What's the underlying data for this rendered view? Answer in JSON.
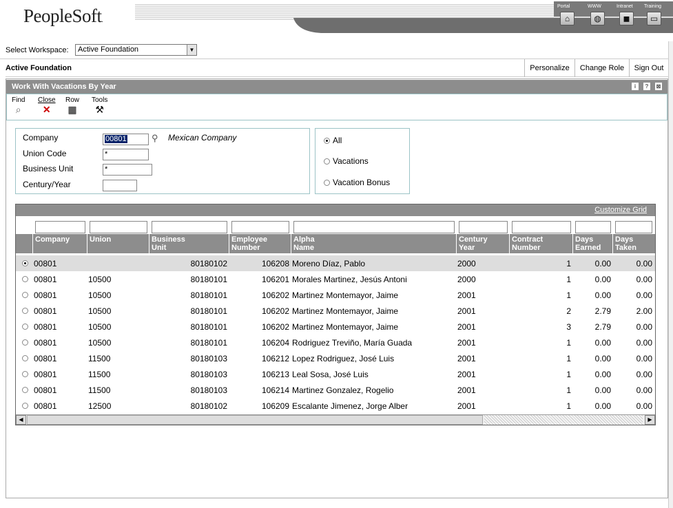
{
  "brand": {
    "logo_text": "PeopleSoft",
    "logo_dot": "."
  },
  "banner": {
    "nav": [
      {
        "label": "Portal",
        "icon": "home-icon",
        "glyph": "⌂"
      },
      {
        "label": "WWW",
        "icon": "globe-icon",
        "glyph": "◍"
      },
      {
        "label": "Intranet",
        "icon": "book-icon",
        "glyph": "◼"
      },
      {
        "label": "Training",
        "icon": "computer-icon",
        "glyph": "▭"
      }
    ]
  },
  "workspace": {
    "label": "Select Workspace:",
    "value": "Active Foundation"
  },
  "topbar": {
    "title": "Active Foundation",
    "personalize": "Personalize",
    "change_role": "Change Role",
    "sign_out": "Sign Out"
  },
  "form": {
    "title": "Work With Vacations By Year"
  },
  "toolbar": {
    "find": "Find",
    "close": "Close",
    "row": "Row",
    "tools": "Tools"
  },
  "fields": {
    "company_label": "Company",
    "company_value": "00801",
    "company_desc": "Mexican Company",
    "union_label": "Union Code",
    "union_value": "*",
    "bu_label": "Business Unit",
    "bu_value": "*",
    "year_label": "Century/Year",
    "year_value": ""
  },
  "radios": {
    "all": "All",
    "vacations": "Vacations",
    "bonus": "Vacation Bonus",
    "selected": "all"
  },
  "grid": {
    "customize": "Customize Grid",
    "columns": [
      {
        "l1": "",
        "l2": "Company"
      },
      {
        "l1": "",
        "l2": "Union"
      },
      {
        "l1": "Business",
        "l2": "Unit"
      },
      {
        "l1": "Employee",
        "l2": "Number"
      },
      {
        "l1": "Alpha",
        "l2": "Name"
      },
      {
        "l1": "Century",
        "l2": "Year"
      },
      {
        "l1": "Contract",
        "l2": "Number"
      },
      {
        "l1": "Days",
        "l2": "Earned"
      },
      {
        "l1": "Days",
        "l2": "Taken"
      }
    ],
    "rows": [
      [
        "00801",
        "",
        "80180102",
        "106208",
        "Moreno Díaz, Pablo",
        "2000",
        "1",
        "0.00",
        "0.00"
      ],
      [
        "00801",
        "10500",
        "80180101",
        "106201",
        "Morales Martinez, Jesús Antoni",
        "2000",
        "1",
        "0.00",
        "0.00"
      ],
      [
        "00801",
        "10500",
        "80180101",
        "106202",
        "Martinez Montemayor, Jaime",
        "2001",
        "1",
        "0.00",
        "0.00"
      ],
      [
        "00801",
        "10500",
        "80180101",
        "106202",
        "Martinez Montemayor, Jaime",
        "2001",
        "2",
        "2.79",
        "2.00"
      ],
      [
        "00801",
        "10500",
        "80180101",
        "106202",
        "Martinez Montemayor, Jaime",
        "2001",
        "3",
        "2.79",
        "0.00"
      ],
      [
        "00801",
        "10500",
        "80180101",
        "106204",
        "Rodriguez Treviño, María Guada",
        "2001",
        "1",
        "0.00",
        "0.00"
      ],
      [
        "00801",
        "11500",
        "80180103",
        "106212",
        "Lopez Rodriguez, José Luis",
        "2001",
        "1",
        "0.00",
        "0.00"
      ],
      [
        "00801",
        "11500",
        "80180103",
        "106213",
        "Leal Sosa, José Luis",
        "2001",
        "1",
        "0.00",
        "0.00"
      ],
      [
        "00801",
        "11500",
        "80180103",
        "106214",
        "Martinez Gonzalez, Rogelio",
        "2001",
        "1",
        "0.00",
        "0.00"
      ],
      [
        "00801",
        "12500",
        "80180102",
        "106209",
        "Escalante Jimenez, Jorge Alber",
        "2001",
        "1",
        "0.00",
        "0.00"
      ]
    ],
    "selected_row": 0
  }
}
